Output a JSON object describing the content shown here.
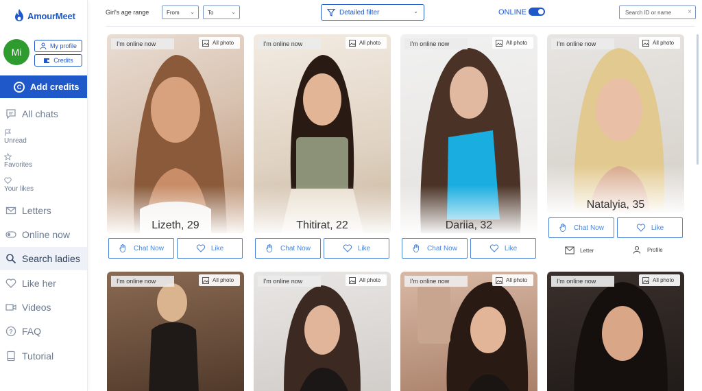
{
  "brand": {
    "name": "AmourMeet"
  },
  "user": {
    "initials": "Mi",
    "my_profile": "My profile",
    "credits": "Credits"
  },
  "sidebar": {
    "add_credits": "Add credits",
    "items": [
      {
        "label": "All chats"
      },
      {
        "label": "Unread"
      },
      {
        "label": "Favorites"
      },
      {
        "label": "Your likes"
      },
      {
        "label": "Letters"
      },
      {
        "label": "Online now"
      },
      {
        "label": "Search ladies"
      },
      {
        "label": "Like her"
      },
      {
        "label": "Videos"
      },
      {
        "label": "FAQ"
      },
      {
        "label": "Tutorial"
      }
    ]
  },
  "filters": {
    "age_label": "Girl's age range",
    "from": "From",
    "to": "To",
    "detailed_filter": "Detailed filter",
    "online_label": "ONLINE",
    "search_placeholder": "Search ID or name"
  },
  "card_labels": {
    "online_badge": "I'm online now",
    "all_photo": "All photo",
    "chat_now": "Chat Now",
    "like": "Like",
    "letter": "Letter",
    "profile": "Profile"
  },
  "profiles": [
    {
      "name": "Lizeth, 29"
    },
    {
      "name": "Thitirat, 22"
    },
    {
      "name": "Dariia, 32"
    },
    {
      "name": "Natalyia, 35"
    }
  ],
  "colors": {
    "accent": "#1f58c8",
    "avatar": "#2e9b2f"
  }
}
